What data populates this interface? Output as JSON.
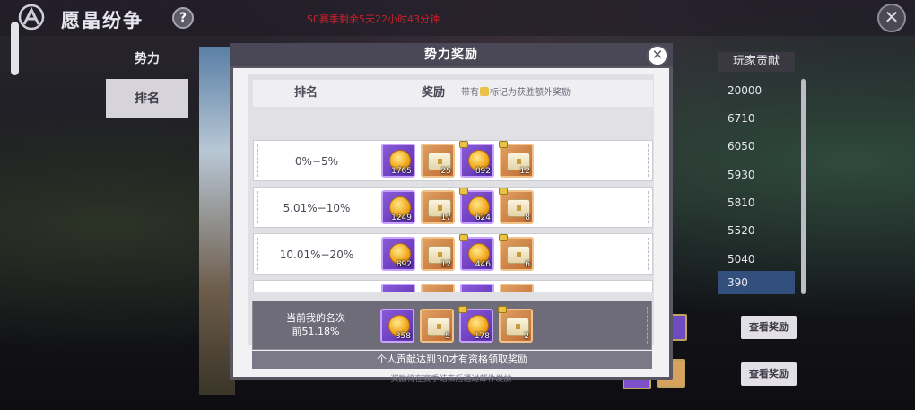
{
  "header": {
    "title": "愿晶纷争",
    "help_label": "?",
    "timer": "S0赛季剩余5天22小时43分钟",
    "close_label": "✕"
  },
  "tabs": [
    {
      "label": "势力"
    },
    {
      "label": "排名"
    }
  ],
  "right_column": {
    "header": "玩家贡献",
    "values": [
      "20000",
      "6710",
      "6050",
      "5930",
      "5810",
      "5520",
      "5040",
      "390"
    ],
    "view_buttons": [
      "查看奖励",
      "查看奖励"
    ]
  },
  "modal": {
    "title": "势力奖励",
    "close_label": "✕",
    "col_rank": "排名",
    "col_reward": "奖励",
    "note_prefix": "带有",
    "note_suffix": "标记为获胜额外奖励",
    "rows": [
      {
        "rank": "0%−5%",
        "items": [
          {
            "type": "coin",
            "qty": "1765",
            "bonus": false
          },
          {
            "type": "chest",
            "qty": "25",
            "bonus": false
          },
          {
            "type": "coin",
            "qty": "892",
            "bonus": true
          },
          {
            "type": "chest",
            "qty": "12",
            "bonus": true
          }
        ]
      },
      {
        "rank": "5.01%−10%",
        "items": [
          {
            "type": "coin",
            "qty": "1249",
            "bonus": false
          },
          {
            "type": "chest",
            "qty": "17",
            "bonus": false
          },
          {
            "type": "coin",
            "qty": "624",
            "bonus": true
          },
          {
            "type": "chest",
            "qty": "8",
            "bonus": true
          }
        ]
      },
      {
        "rank": "10.01%−20%",
        "items": [
          {
            "type": "coin",
            "qty": "892",
            "bonus": false
          },
          {
            "type": "chest",
            "qty": "12",
            "bonus": false
          },
          {
            "type": "coin",
            "qty": "446",
            "bonus": true
          },
          {
            "type": "chest",
            "qty": "6",
            "bonus": true
          }
        ]
      }
    ],
    "my_rank_label": "当前我的名次",
    "my_rank_value": "前51.18%",
    "my_items": [
      {
        "type": "coin",
        "qty": "358",
        "bonus": false
      },
      {
        "type": "chest",
        "qty": "5",
        "bonus": false
      },
      {
        "type": "coin",
        "qty": "178",
        "bonus": true
      },
      {
        "type": "chest",
        "qty": "2",
        "bonus": true
      }
    ],
    "warning": "个人贡献达到30才有资格领取奖励",
    "footer": "奖励将在赛季结束后通过邮件发放"
  },
  "colors": {
    "accent_blue": "#33507d",
    "timer_red": "#c8232c",
    "modal_frame": "#5a5765"
  }
}
